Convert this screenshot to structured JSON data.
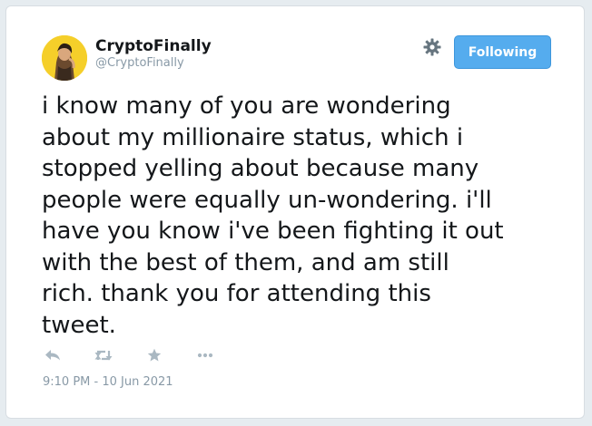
{
  "user": {
    "display_name": "CryptoFinally",
    "handle": "@CryptoFinally",
    "avatar_icon": "avatar-image"
  },
  "header": {
    "settings_icon": "gear-icon",
    "follow_button_label": "Following"
  },
  "tweet": {
    "text": "i know many of you are wondering\nabout my millionaire status, which i\nstopped yelling about because many\npeople were equally un-wondering. i'll\nhave you know i've been fighting it out\nwith the best of them, and am still\nrich. thank you for attending this\ntweet.",
    "timestamp": "9:10 PM - 10 Jun 2021"
  },
  "actions": [
    {
      "icon": "reply-icon"
    },
    {
      "icon": "retweet-icon"
    },
    {
      "icon": "like-star-icon"
    },
    {
      "icon": "more-icon"
    }
  ],
  "colors": {
    "accent": "#55acee",
    "text": "#14171a",
    "muted": "#8899a6",
    "icon_muted": "#aab8c2"
  }
}
